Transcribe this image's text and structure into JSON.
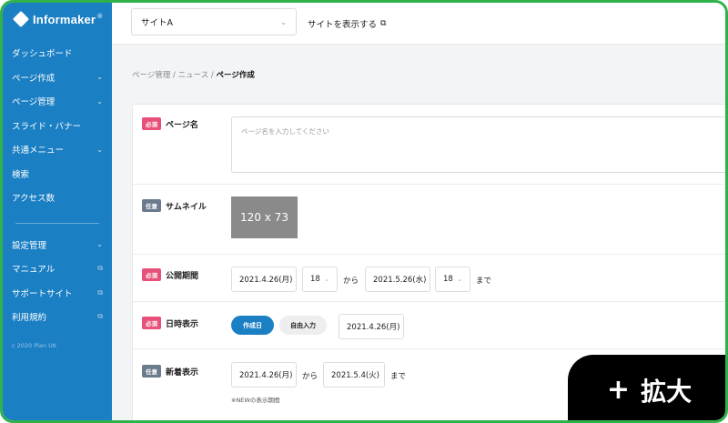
{
  "brand": {
    "name": "Informaker",
    "registered": "®"
  },
  "sidebar": {
    "items": [
      {
        "label": "ダッシュボード",
        "icon": ""
      },
      {
        "label": "ページ作成",
        "icon": "chevron-down-icon"
      },
      {
        "label": "ページ管理",
        "icon": "chevron-down-icon"
      },
      {
        "label": "スライド・バナー",
        "icon": ""
      },
      {
        "label": "共通メニュー",
        "icon": "chevron-down-icon"
      },
      {
        "label": "検索",
        "icon": ""
      },
      {
        "label": "アクセス数",
        "icon": ""
      }
    ],
    "items2": [
      {
        "label": "設定管理",
        "icon": "chevron-down-icon"
      },
      {
        "label": "マニュアル",
        "icon": "external-link-icon"
      },
      {
        "label": "サポートサイト",
        "icon": "external-link-icon"
      },
      {
        "label": "利用規約",
        "icon": "external-link-icon"
      }
    ],
    "copyright": "c 2020 Plan UK"
  },
  "topbar": {
    "site_select_value": "サイトA",
    "view_site_label": "サイトを表示する"
  },
  "breadcrumb": {
    "item1": "ページ管理",
    "sep": "/",
    "item2": "ニュース",
    "current": "ページ作成"
  },
  "badges": {
    "required": "必須",
    "optional": "任意"
  },
  "form": {
    "page_name": {
      "label": "ページ名",
      "placeholder": "ページ名を入力してください"
    },
    "thumbnail": {
      "label": "サムネイル",
      "size_text": "120 x 73"
    },
    "publish_period": {
      "label": "公開期間",
      "start_date": "2021.4.26(月)",
      "start_hour": "18",
      "from": "から",
      "end_date": "2021.5.26(水)",
      "end_hour": "18",
      "until": "まで"
    },
    "datetime_display": {
      "label": "日時表示",
      "option_created": "作成日",
      "option_free": "自由入力",
      "date": "2021.4.26(月)"
    },
    "new_display": {
      "label": "新着表示",
      "start_date": "2021.4.26(月)",
      "from": "から",
      "end_date": "2021.5.4(火)",
      "until": "まで",
      "note": "※NEWの表示期間"
    }
  },
  "zoom_button": {
    "label": "拡大"
  },
  "colors": {
    "sidebar": "#1b7fc4",
    "required": "#e8507a",
    "optional": "#6b7a8c",
    "frame": "#2fb24a"
  }
}
